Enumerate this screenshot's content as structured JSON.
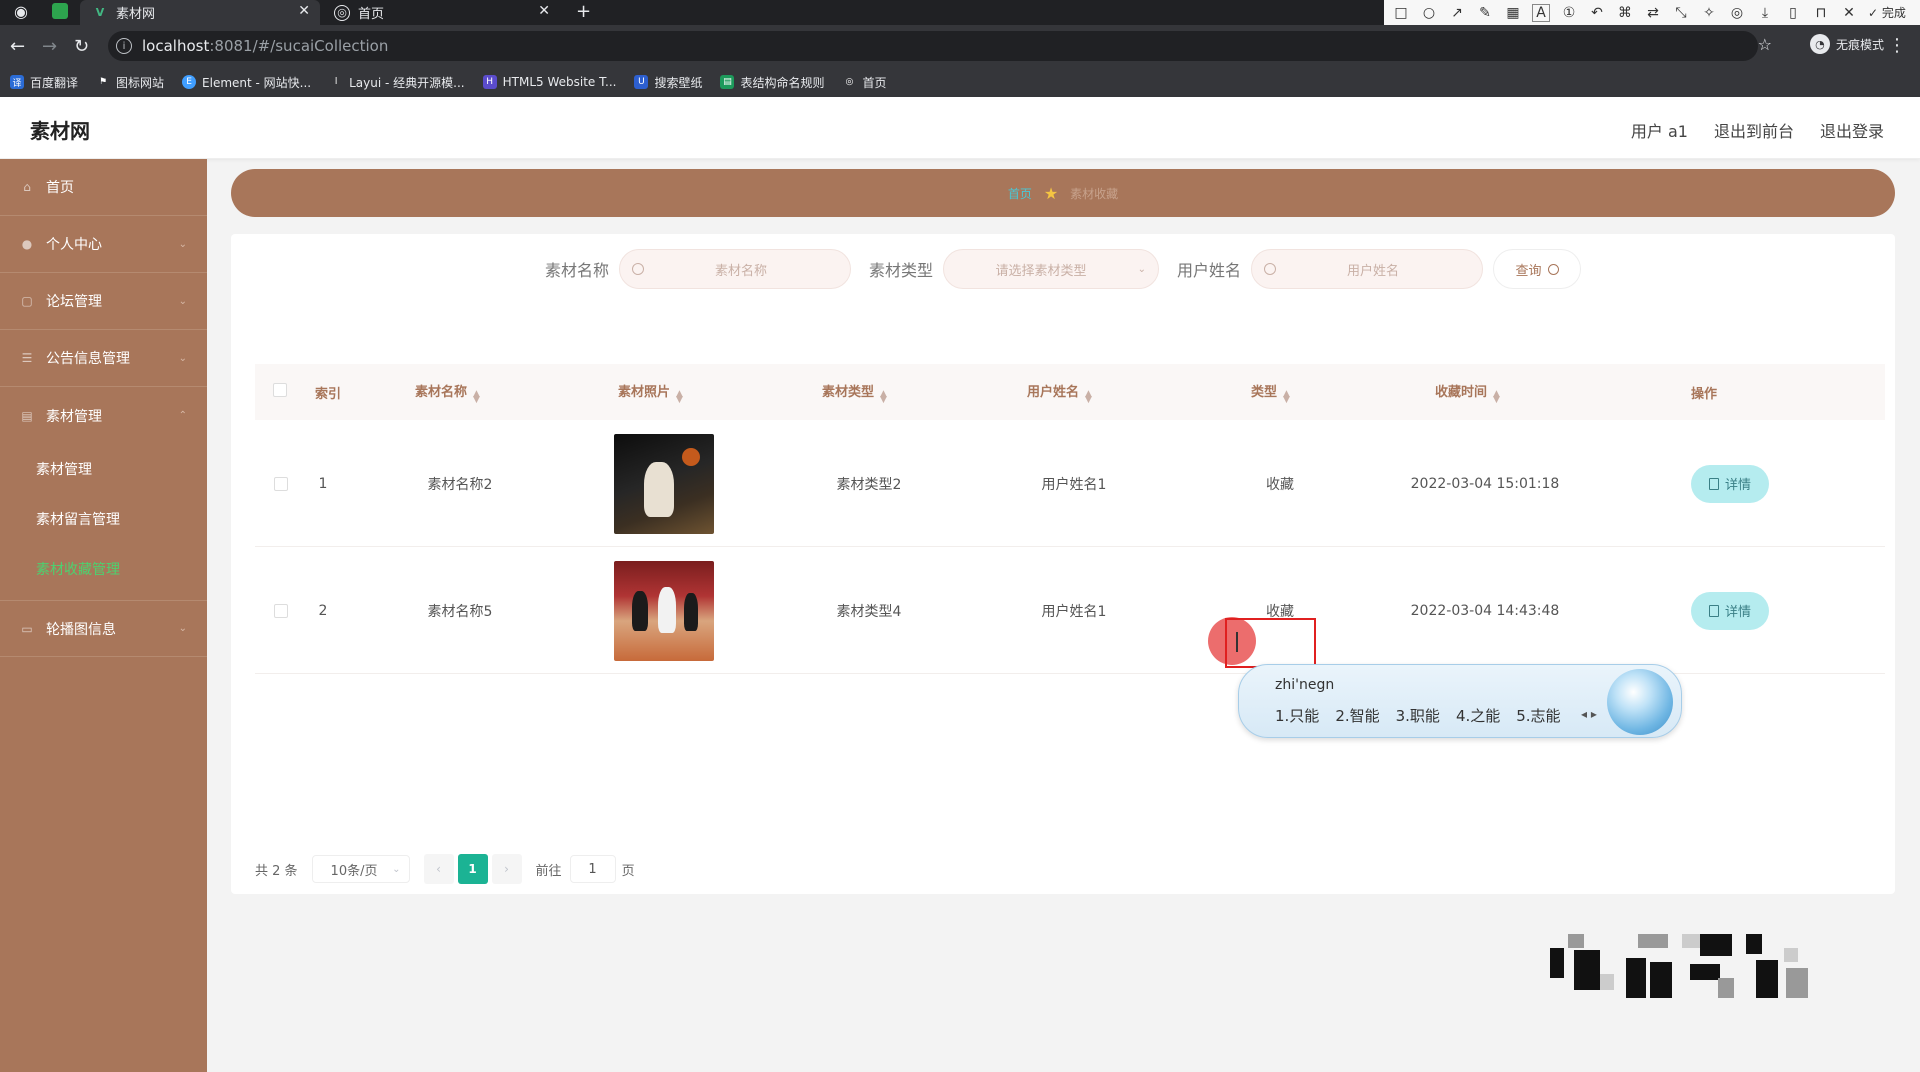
{
  "browser": {
    "tabs": [
      {
        "title": "素材网",
        "active": true
      },
      {
        "title": "首页",
        "active": false
      }
    ],
    "url_host": "localhost",
    "url_rest": ":8081/#/sucaiCollection",
    "incognito_label": "无痕模式",
    "bookmarks": [
      "百度翻译",
      "图标网站",
      "Element - 网站快...",
      "Layui - 经典开源模...",
      "HTML5 Website T...",
      "搜索壁纸",
      "表结构命名规则",
      "首页"
    ],
    "annotation_toolbar": {
      "done_label": "完成",
      "font_size": "20",
      "current_color": "#f23d3d",
      "palette": [
        "#000000",
        "#7f7f7f",
        "#880015",
        "#ed1c24",
        "#ff7f27",
        "#22b14c",
        "#3f48cc",
        "#a349a4",
        "#ffffff",
        "#c3c3c3",
        "#b97a57",
        "#ffaec9",
        "#fff200",
        "#b5e61d",
        "#99d9ea",
        "#7092be"
      ]
    }
  },
  "app": {
    "brand": "素材网",
    "header_links": [
      "用户 a1",
      "退出到前台",
      "退出登录"
    ]
  },
  "sidebar": {
    "items": [
      {
        "label": "首页",
        "icon": "home-icon"
      },
      {
        "label": "个人中心",
        "icon": "user-icon"
      },
      {
        "label": "论坛管理",
        "icon": "forum-icon"
      },
      {
        "label": "公告信息管理",
        "icon": "notice-icon"
      },
      {
        "label": "素材管理",
        "icon": "material-icon"
      }
    ],
    "sub_items": [
      {
        "label": "素材管理",
        "active": false
      },
      {
        "label": "素材留言管理",
        "active": false
      },
      {
        "label": "素材收藏管理",
        "active": true
      }
    ],
    "last_item": {
      "label": "轮播图信息",
      "icon": "carousel-icon"
    }
  },
  "breadcrumb": {
    "home": "首页",
    "current": "素材收藏"
  },
  "search": {
    "name_label": "素材名称",
    "name_placeholder": "素材名称",
    "type_label": "素材类型",
    "type_placeholder": "请选择素材类型",
    "user_label": "用户姓名",
    "user_placeholder": "用户姓名",
    "query_label": "查询"
  },
  "table": {
    "headers": [
      "索引",
      "素材名称",
      "素材照片",
      "素材类型",
      "用户姓名",
      "类型",
      "收藏时间",
      "操作"
    ],
    "rows": [
      {
        "index": "1",
        "name": "素材名称2",
        "type": "素材类型2",
        "user": "用户姓名1",
        "kind": "收藏",
        "time": "2022-03-04 15:01:18",
        "action": "详情"
      },
      {
        "index": "2",
        "name": "素材名称5",
        "type": "素材类型4",
        "user": "用户姓名1",
        "kind": "收藏",
        "time": "2022-03-04 14:43:48",
        "action": "详情"
      }
    ]
  },
  "pagination": {
    "total": "共 2 条",
    "page_size": "10条/页",
    "current_page": "1",
    "goto_prefix": "前往",
    "goto_value": "1",
    "goto_suffix": "页"
  },
  "ime": {
    "pinyin": "zhi'negn",
    "candidates": [
      "1.只能",
      "2.智能",
      "3.职能",
      "4.之能",
      "5.志能"
    ]
  }
}
